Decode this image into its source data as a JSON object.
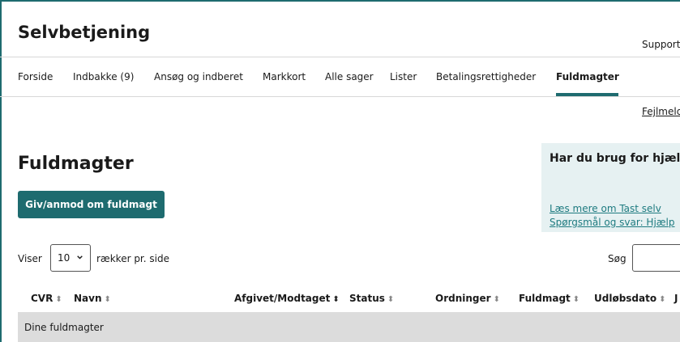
{
  "header": {
    "app_title": "Selvbetjening",
    "support_label": "Support"
  },
  "nav": {
    "items": [
      {
        "label": "Forside"
      },
      {
        "label": "Indbakke (9)"
      },
      {
        "label": "Ansøg og indberet"
      },
      {
        "label": "Markkort"
      },
      {
        "label": "Alle sager"
      },
      {
        "label": "Lister"
      },
      {
        "label": "Betalingsrettigheder"
      },
      {
        "label": "Fuldmagter",
        "active": true
      }
    ]
  },
  "error_link": "Fejlmeld",
  "main": {
    "title": "Fuldmagter",
    "primary_button": "Giv/anmod om fuldmagt"
  },
  "help": {
    "title": "Har du brug for hjælp",
    "links": [
      "Læs mere om Tast selv",
      "Spørgsmål og svar: Hjælp"
    ]
  },
  "table_controls": {
    "show_label": "Viser",
    "page_size": "10",
    "rows_label": "rækker pr. side",
    "search_label": "Søg",
    "search_value": ""
  },
  "table": {
    "columns": [
      "CVR",
      "Navn",
      "Afgivet/Modtaget",
      "Status",
      "Ordninger",
      "Fuldmagt",
      "Udløbsdato",
      "J"
    ],
    "group_label": "Dine fuldmagter"
  },
  "colors": {
    "accent": "#1e6b6f",
    "help_bg": "#e6f1f2",
    "link": "#1e7b80",
    "group_row_bg": "#dcdcdc"
  },
  "icons": {
    "sort": "sort-icon",
    "dropdown": "chevron-down-icon"
  }
}
